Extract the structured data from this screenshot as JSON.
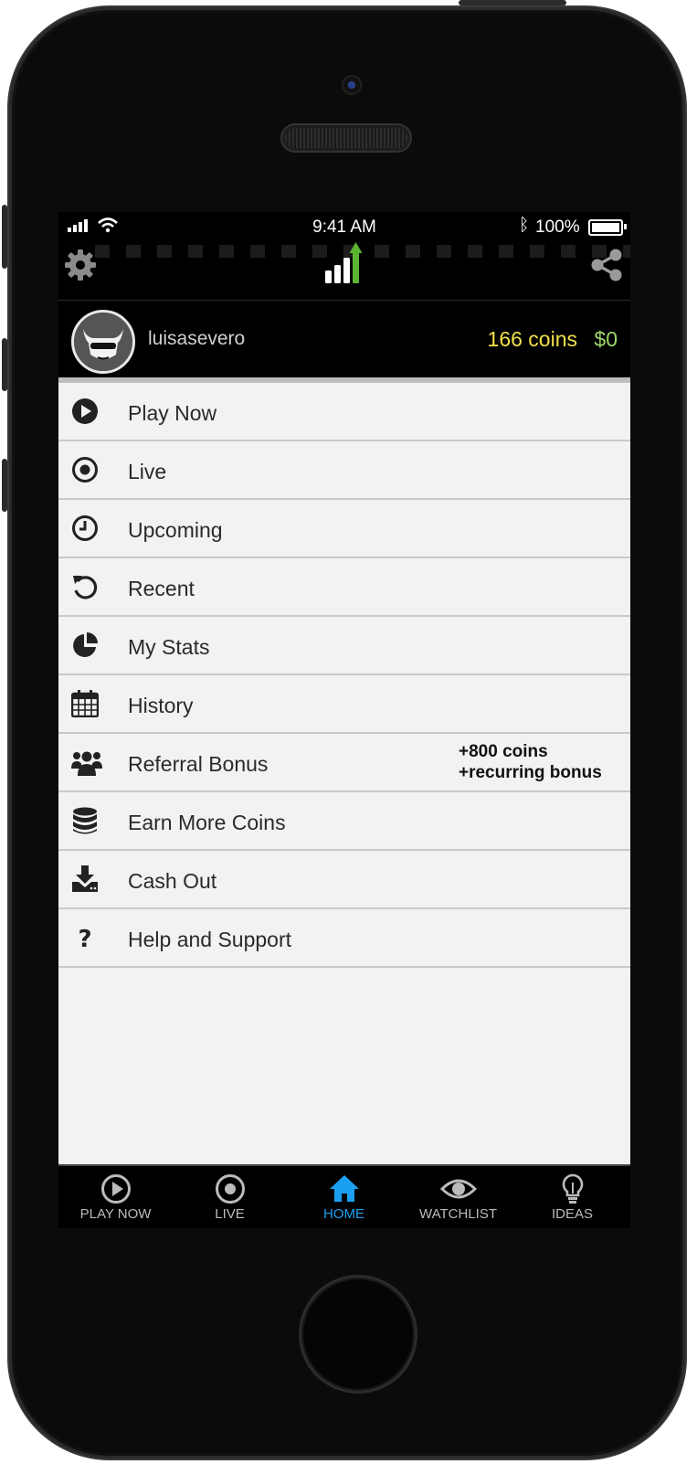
{
  "status_bar": {
    "time": "9:41 AM",
    "battery": "100%"
  },
  "profile": {
    "username": "luisasevero",
    "coins": "166 coins",
    "money": "$0"
  },
  "menu": [
    {
      "label": "Play Now",
      "icon": "play-circle-icon"
    },
    {
      "label": "Live",
      "icon": "live-target-icon"
    },
    {
      "label": "Upcoming",
      "icon": "clock-icon"
    },
    {
      "label": "Recent",
      "icon": "history-undo-icon"
    },
    {
      "label": "My Stats",
      "icon": "pie-chart-icon"
    },
    {
      "label": "History",
      "icon": "calendar-icon"
    },
    {
      "label": "Referral Bonus",
      "icon": "users-icon",
      "note_line1": "+800 coins",
      "note_line2": "+recurring bonus"
    },
    {
      "label": "Earn More Coins",
      "icon": "coin-stack-icon"
    },
    {
      "label": "Cash Out",
      "icon": "download-icon"
    },
    {
      "label": "Help and Support",
      "icon": "question-icon"
    }
  ],
  "tabs": [
    {
      "label": "PLAY NOW",
      "icon": "play-circle-icon"
    },
    {
      "label": "LIVE",
      "icon": "live-target-icon"
    },
    {
      "label": "HOME",
      "icon": "home-icon",
      "active": true
    },
    {
      "label": "WATCHLIST",
      "icon": "eye-icon"
    },
    {
      "label": "IDEAS",
      "icon": "lightbulb-icon"
    }
  ],
  "colors": {
    "coins": "#f2e14a",
    "money": "#9fd86a",
    "active_tab": "#1b9ff0",
    "logo_arrow": "#5cb531"
  }
}
